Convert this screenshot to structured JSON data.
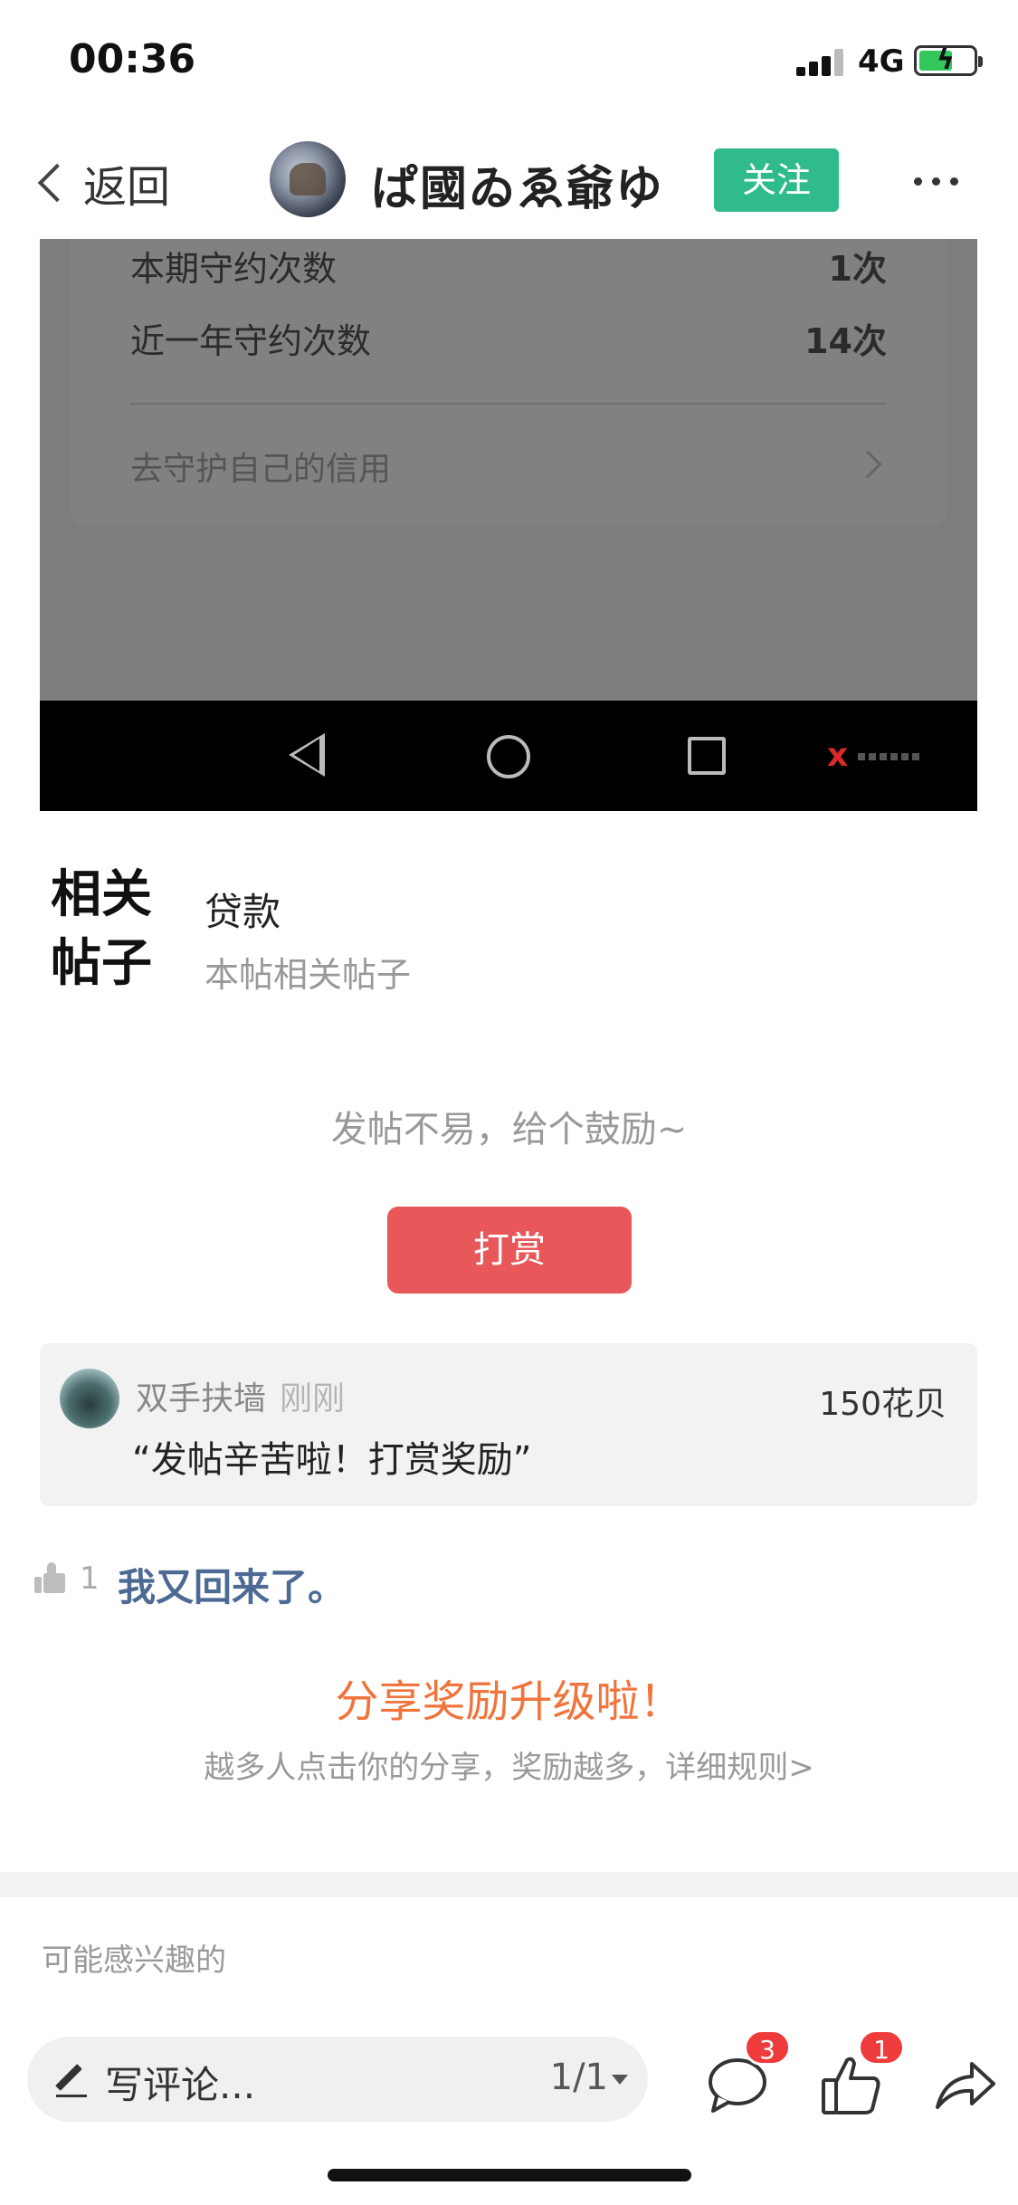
{
  "status_bar": {
    "time": "00:36",
    "network": "4G"
  },
  "nav": {
    "back_label": "返回",
    "title": "ぱ國ゐゑ爺ゆ",
    "follow_label": "关注"
  },
  "embedded_screenshot": {
    "rows": [
      {
        "label": "本期守约次数",
        "value": "1次"
      },
      {
        "label": "近一年守约次数",
        "value": "14次"
      }
    ],
    "link_text": "去守护自己的信用"
  },
  "related": {
    "brand_line1": "相关",
    "brand_line2": "帖子",
    "tag": "贷款",
    "subtitle": "本帖相关帖子"
  },
  "encourage_text": "发帖不易，给个鼓励~",
  "reward_button": "打赏",
  "reward_record": {
    "user": "双手扶墙",
    "time": "刚刚",
    "amount": "150花贝",
    "message": "“发帖辛苦啦！打赏奖励”"
  },
  "comment": {
    "likes": "1",
    "text": "我又回来了。"
  },
  "share": {
    "title": "分享奖励升级啦！",
    "subtitle": "越多人点击你的分享，奖励越多，详细规则>"
  },
  "recommend_label": "可能感兴趣的",
  "bottom_bar": {
    "comment_placeholder": "写评论...",
    "page_indicator": "1/1",
    "comment_badge": "3",
    "like_badge": "1"
  },
  "colors": {
    "follow": "#2fbb8c",
    "reward": "#e8575a",
    "share": "#f0743c",
    "badge": "#ee3b3b",
    "comment_text": "#4d6a94"
  },
  "icons": [
    "back-chevron-icon",
    "more-icon",
    "android-back-icon",
    "android-home-icon",
    "android-recent-icon",
    "thumb-up-icon",
    "pencil-icon",
    "caret-down-icon",
    "chat-bubble-icon",
    "like-icon",
    "share-icon"
  ]
}
